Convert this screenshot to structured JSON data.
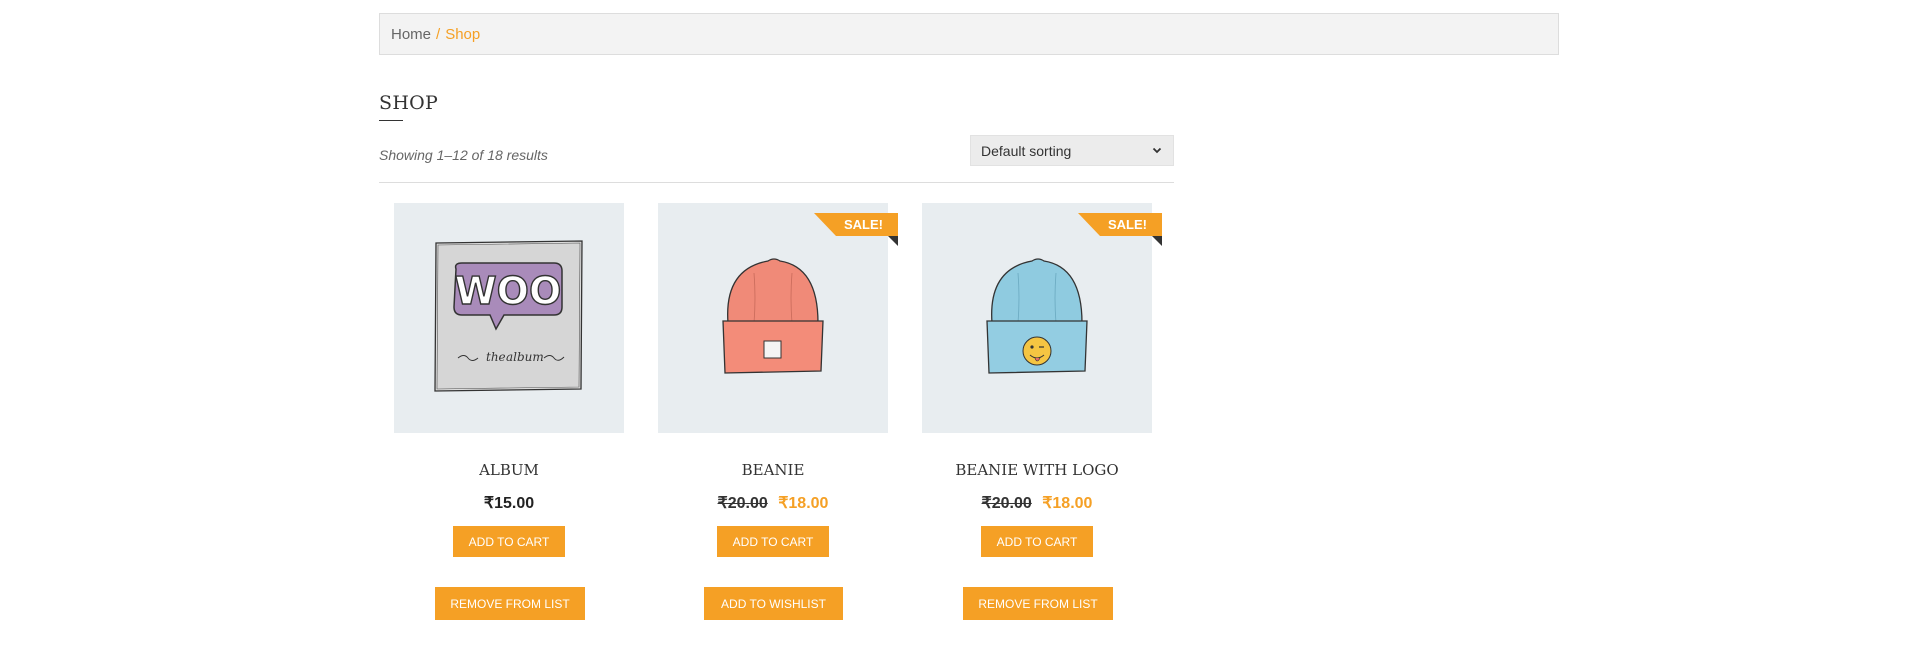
{
  "breadcrumb": {
    "home": "Home",
    "separator": "/",
    "current": "Shop"
  },
  "page": {
    "title": "SHOP",
    "result_count": "Showing 1–12 of 18 results",
    "sorting": {
      "selected": "Default sorting"
    }
  },
  "colors": {
    "accent": "#f5a025",
    "image_bg": "#e8edf0"
  },
  "products": [
    {
      "name": "ALBUM",
      "image": "woo-album-image",
      "price": "₹15.00",
      "add_to_cart": "ADD TO CART",
      "wishlist": "REMOVE FROM LIST"
    },
    {
      "name": "BEANIE",
      "image": "pink-beanie-image",
      "sale_badge": "SALE!",
      "old_price": "₹20.00",
      "new_price": "₹18.00",
      "add_to_cart": "ADD TO CART",
      "wishlist": "ADD TO WISHLIST"
    },
    {
      "name": "BEANIE WITH LOGO",
      "image": "blue-beanie-with-logo-image",
      "sale_badge": "SALE!",
      "old_price": "₹20.00",
      "new_price": "₹18.00",
      "add_to_cart": "ADD TO CART",
      "wishlist": "REMOVE FROM LIST"
    }
  ],
  "album_art": {
    "logo_text": "WOO",
    "caption_left": "the",
    "caption_right": "album"
  }
}
